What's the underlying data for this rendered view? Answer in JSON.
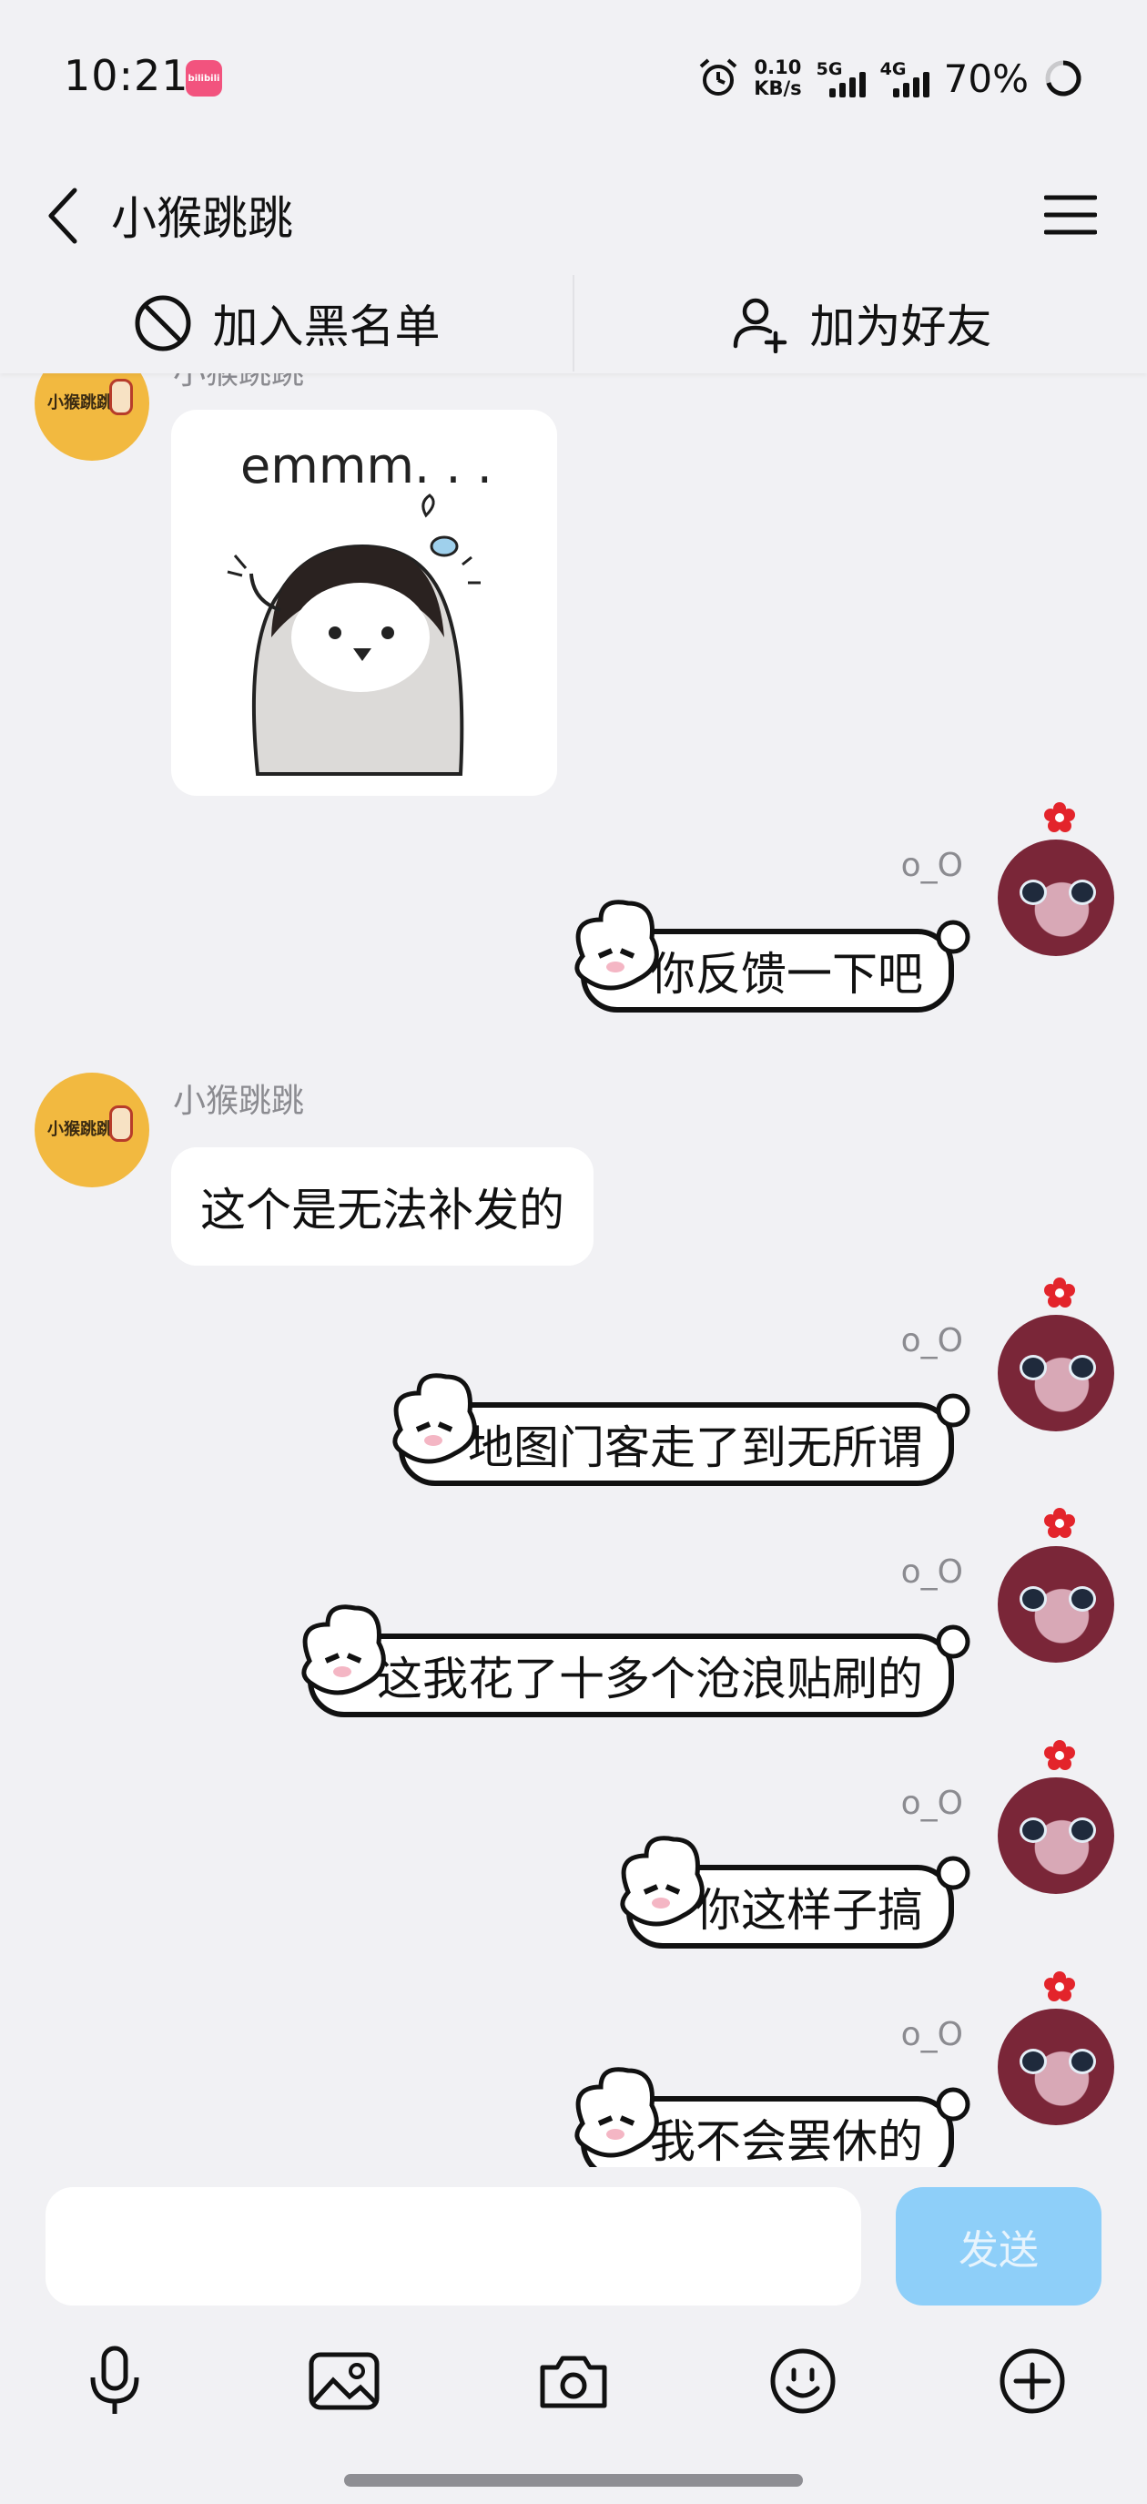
{
  "status_bar": {
    "time": "10:21",
    "app_icon_text": "bilibili",
    "net_speed_value": "0.10",
    "net_speed_unit": "KB/s",
    "network_1": "5G",
    "network_2": "4G",
    "battery": "70%"
  },
  "header": {
    "title": "小猴跳跳"
  },
  "actions": {
    "block_label": "加入黑名单",
    "add_friend_label": "加为好友"
  },
  "messages": [
    {
      "side": "left",
      "sender": "小猴跳跳",
      "type": "sticker",
      "sticker_text": "emmm. . ."
    },
    {
      "side": "right",
      "sender": "o_O",
      "type": "text",
      "text": "你反馈一下吧"
    },
    {
      "side": "left",
      "sender": "小猴跳跳",
      "type": "text",
      "text": "这个是无法补发的"
    },
    {
      "side": "right",
      "sender": "o_O",
      "type": "text",
      "text": "地图门客走了到无所谓"
    },
    {
      "side": "right",
      "sender": "o_O",
      "type": "text",
      "text": "这我花了十多个沧浪贴刷的"
    },
    {
      "side": "right",
      "sender": "o_O",
      "type": "text",
      "text": "你这样子搞"
    },
    {
      "side": "right",
      "sender": "o_O",
      "type": "text",
      "text": "我不会罢休的"
    }
  ],
  "input": {
    "value": "",
    "send_label": "发送"
  },
  "toolbar_icons": [
    "microphone-icon",
    "image-icon",
    "camera-icon",
    "emoji-icon",
    "plus-icon"
  ],
  "colors": {
    "background": "#f1f1f4",
    "send_button": "#8ecff9",
    "left_avatar": "#f2b940"
  }
}
